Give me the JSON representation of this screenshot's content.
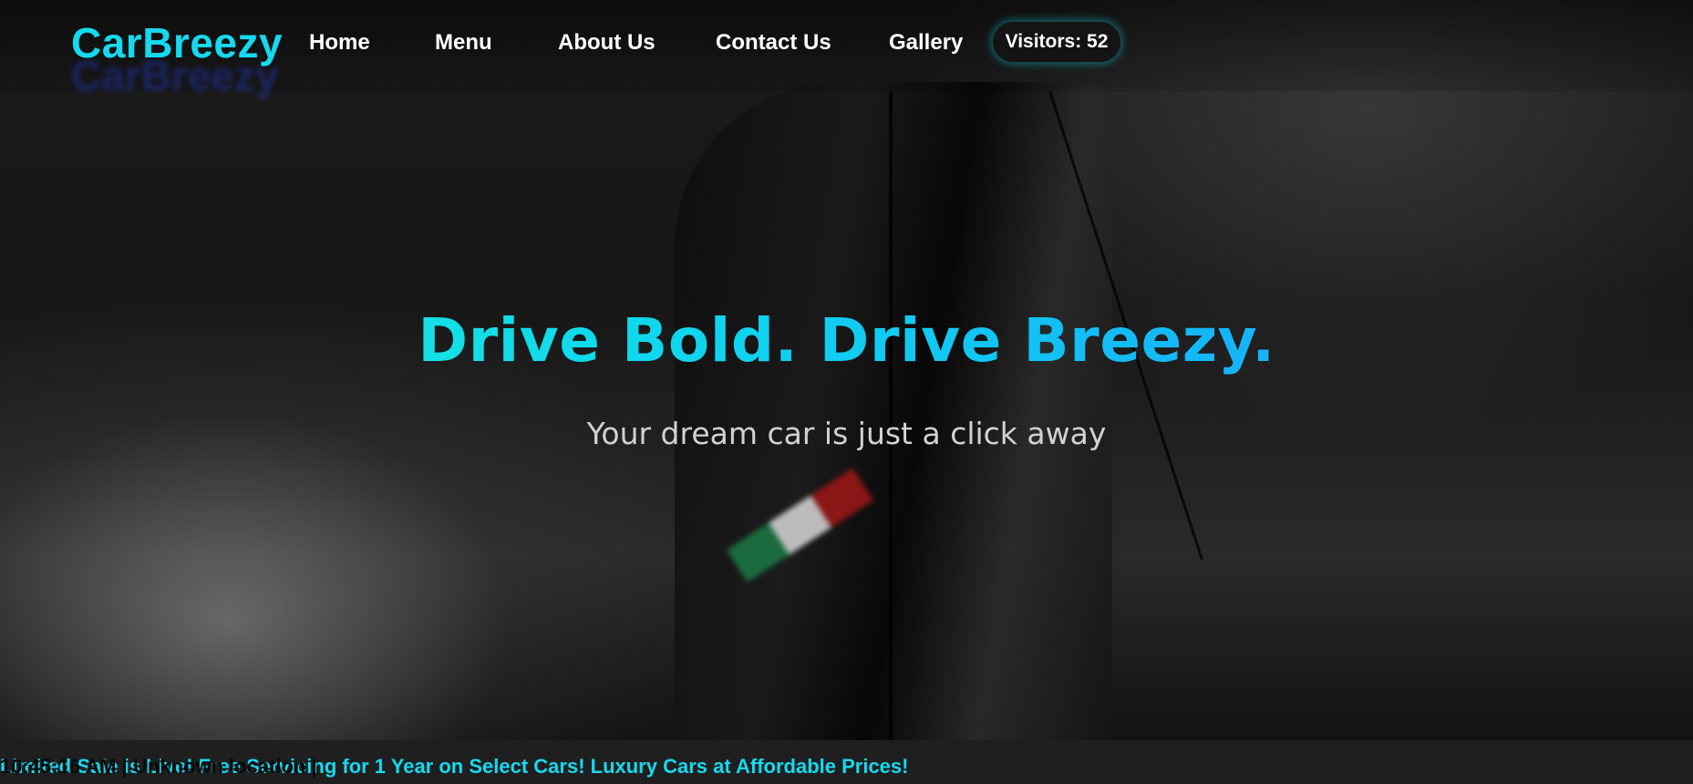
{
  "brand": {
    "name": "CarBreezy",
    "accent_color": "#16d9ef"
  },
  "nav": {
    "links": [
      {
        "label": "Home"
      },
      {
        "label": "Menu"
      },
      {
        "label": "About Us"
      },
      {
        "label": "Contact Us"
      },
      {
        "label": "Gallery"
      }
    ],
    "visitors_label": "Visitors: 52"
  },
  "hero": {
    "title": "Drive Bold. Drive Breezy.",
    "subtitle": "Your dream car is just a click away",
    "gradient_colors": [
      "#1cf0d6",
      "#0fd6ee",
      "#1a9bff"
    ]
  },
  "footer_bar": {
    "ticker": "Limited Sale is Live! Free Servicing for 1 Year on Select Cars! Luxury Cars at Affordable Prices!",
    "clock": "10:45:16 AM | Unknown location |"
  }
}
